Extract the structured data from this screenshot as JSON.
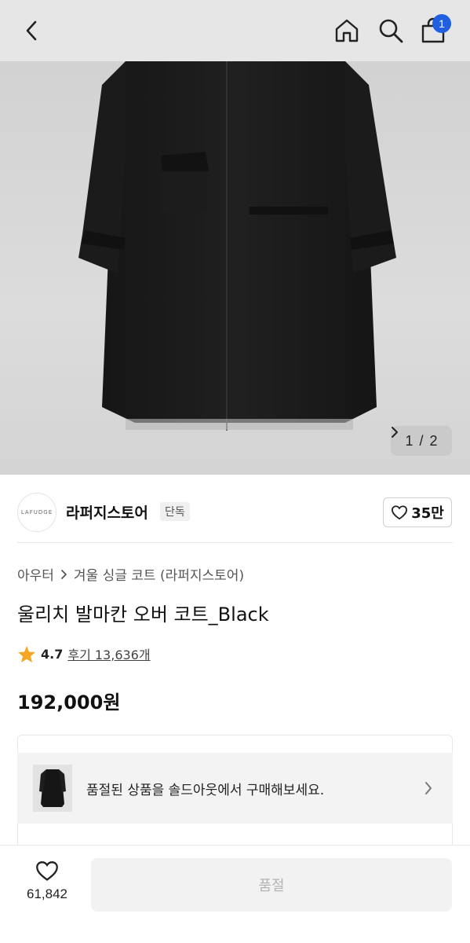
{
  "header": {
    "back_icon": "chevron-left-icon",
    "home_icon": "home-icon",
    "search_icon": "search-icon",
    "cart_icon": "shopping-bag-icon",
    "cart_count": "1",
    "badge_color": "#1f5fe0"
  },
  "gallery": {
    "current": "1",
    "separator": "/",
    "total": "2",
    "next_icon": "chevron-right-icon"
  },
  "store": {
    "logo_text": "LAFUDGE",
    "name": "라퍼지스토어",
    "tag": "단독",
    "likes": "35만",
    "like_icon": "heart-outline-icon"
  },
  "product": {
    "breadcrumb": [
      "아우터",
      "겨울 싱글 코트 (라퍼지스토어)"
    ],
    "title": "울리치 발마칸 오버 코트_Black",
    "rating": "4.7",
    "reviews": "후기 13,636개",
    "price": "192,000원",
    "star_color": "#f5a623"
  },
  "soldout_banner": {
    "text": "품절된 상품을 솔드아웃에서 구매해보세요."
  },
  "bottom": {
    "wish_count": "61,842",
    "buy_label": "품절"
  }
}
